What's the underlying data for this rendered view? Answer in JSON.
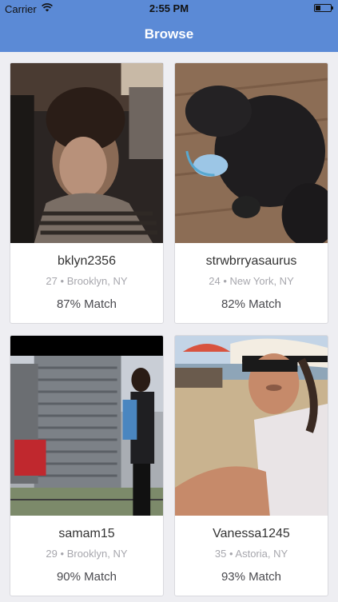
{
  "status_bar": {
    "carrier": "Carrier",
    "time": "2:55 PM",
    "battery_level": 0.35
  },
  "nav": {
    "title": "Browse"
  },
  "profiles": [
    {
      "username": "bklyn2356",
      "age": "27",
      "location": "Brooklyn, NY",
      "match": "87% Match"
    },
    {
      "username": "strwbrryasaurus",
      "age": "24",
      "location": "New York, NY",
      "match": "82% Match"
    },
    {
      "username": "samam15",
      "age": "29",
      "location": "Brooklyn, NY",
      "match": "90% Match"
    },
    {
      "username": "Vanessa1245",
      "age": "35",
      "location": "Astoria, NY",
      "match": "93% Match"
    }
  ],
  "separator": "•",
  "colors": {
    "nav_background": "#5b8ad6",
    "page_background": "#eeeef2",
    "card_background": "#ffffff"
  }
}
